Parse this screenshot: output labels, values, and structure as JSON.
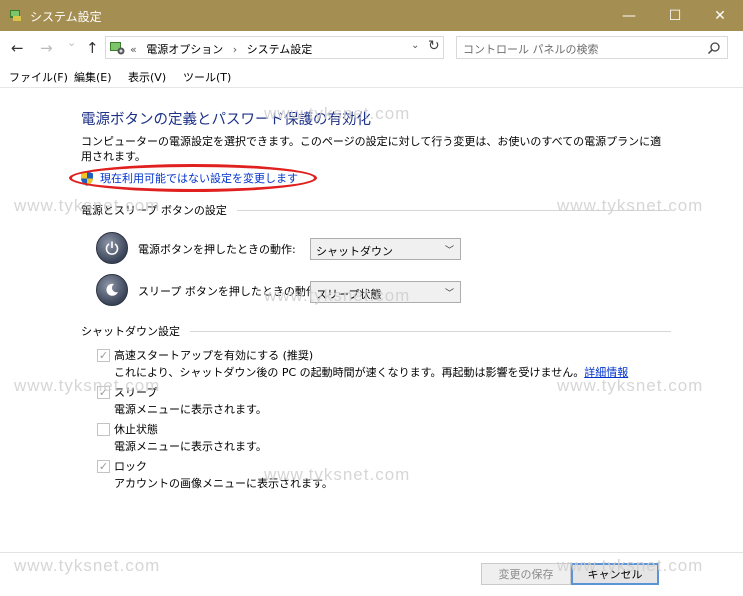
{
  "window": {
    "title": "システム設定",
    "controls": {
      "minimize": "—",
      "maximize": "☐",
      "close": "✕"
    }
  },
  "nav": {
    "back_icon": "←",
    "forward_icon": "→",
    "recent_icon": "⌄",
    "up_icon": "↑",
    "breadcrumb": [
      "«",
      "電源オプション",
      "›",
      "システム設定"
    ],
    "refresh_icon": "↻",
    "dropdown_icon": "⌄",
    "search_placeholder": "コントロール パネルの検索"
  },
  "menu": {
    "items": [
      "ファイル(F)",
      "編集(E)",
      "表示(V)",
      "ツール(T)"
    ]
  },
  "main": {
    "title": "電源ボタンの定義とパスワード保護の有効化",
    "description": "コンピューターの電源設定を選択できます。このページの設定に対して行う変更は、お使いのすべての電源プランに適用されます。",
    "change_link": "現在利用可能ではない設定を変更します",
    "power_group": {
      "header": "電源とスリープ ボタンの設定",
      "rows": [
        {
          "label": "電源ボタンを押したときの動作:",
          "value": "シャットダウン"
        },
        {
          "label": "スリープ ボタンを押したときの動作:",
          "value": "スリープ状態"
        }
      ]
    },
    "shutdown_group": {
      "header": "シャットダウン設定",
      "items": [
        {
          "label": "高速スタートアップを有効にする (推奨)",
          "desc": "これにより、シャットダウン後の PC の起動時間が速くなります。再起動は影響を受けません。",
          "link": "詳細情報",
          "checked": true
        },
        {
          "label": "スリープ",
          "desc": "電源メニューに表示されます。",
          "checked": true
        },
        {
          "label": "休止状態",
          "desc": "電源メニューに表示されます。",
          "checked": false
        },
        {
          "label": "ロック",
          "desc": "アカウントの画像メニューに表示されます。",
          "checked": true
        }
      ]
    }
  },
  "footer": {
    "save_label": "変更の保存",
    "cancel_label": "キャンセル"
  },
  "watermark": "www.tyksnet.com",
  "colors": {
    "titlebar": "#a48e52",
    "heading": "#1e3287",
    "link": "#0033cc",
    "highlight": "#e0201f"
  }
}
